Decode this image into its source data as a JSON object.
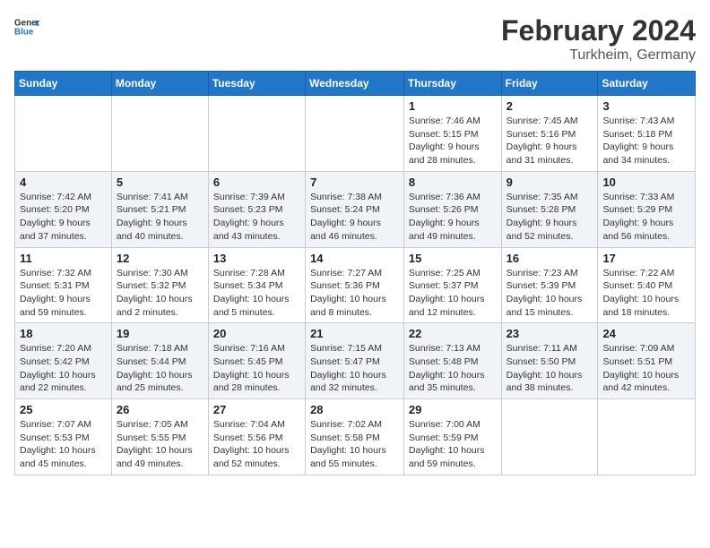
{
  "header": {
    "logo": {
      "line1": "General",
      "line2": "Blue"
    },
    "month": "February 2024",
    "location": "Turkheim, Germany"
  },
  "weekdays": [
    "Sunday",
    "Monday",
    "Tuesday",
    "Wednesday",
    "Thursday",
    "Friday",
    "Saturday"
  ],
  "weeks": [
    [
      null,
      null,
      null,
      null,
      {
        "day": "1",
        "sunrise": "Sunrise: 7:46 AM",
        "sunset": "Sunset: 5:15 PM",
        "daylight": "Daylight: 9 hours and 28 minutes."
      },
      {
        "day": "2",
        "sunrise": "Sunrise: 7:45 AM",
        "sunset": "Sunset: 5:16 PM",
        "daylight": "Daylight: 9 hours and 31 minutes."
      },
      {
        "day": "3",
        "sunrise": "Sunrise: 7:43 AM",
        "sunset": "Sunset: 5:18 PM",
        "daylight": "Daylight: 9 hours and 34 minutes."
      }
    ],
    [
      {
        "day": "4",
        "sunrise": "Sunrise: 7:42 AM",
        "sunset": "Sunset: 5:20 PM",
        "daylight": "Daylight: 9 hours and 37 minutes."
      },
      {
        "day": "5",
        "sunrise": "Sunrise: 7:41 AM",
        "sunset": "Sunset: 5:21 PM",
        "daylight": "Daylight: 9 hours and 40 minutes."
      },
      {
        "day": "6",
        "sunrise": "Sunrise: 7:39 AM",
        "sunset": "Sunset: 5:23 PM",
        "daylight": "Daylight: 9 hours and 43 minutes."
      },
      {
        "day": "7",
        "sunrise": "Sunrise: 7:38 AM",
        "sunset": "Sunset: 5:24 PM",
        "daylight": "Daylight: 9 hours and 46 minutes."
      },
      {
        "day": "8",
        "sunrise": "Sunrise: 7:36 AM",
        "sunset": "Sunset: 5:26 PM",
        "daylight": "Daylight: 9 hours and 49 minutes."
      },
      {
        "day": "9",
        "sunrise": "Sunrise: 7:35 AM",
        "sunset": "Sunset: 5:28 PM",
        "daylight": "Daylight: 9 hours and 52 minutes."
      },
      {
        "day": "10",
        "sunrise": "Sunrise: 7:33 AM",
        "sunset": "Sunset: 5:29 PM",
        "daylight": "Daylight: 9 hours and 56 minutes."
      }
    ],
    [
      {
        "day": "11",
        "sunrise": "Sunrise: 7:32 AM",
        "sunset": "Sunset: 5:31 PM",
        "daylight": "Daylight: 9 hours and 59 minutes."
      },
      {
        "day": "12",
        "sunrise": "Sunrise: 7:30 AM",
        "sunset": "Sunset: 5:32 PM",
        "daylight": "Daylight: 10 hours and 2 minutes."
      },
      {
        "day": "13",
        "sunrise": "Sunrise: 7:28 AM",
        "sunset": "Sunset: 5:34 PM",
        "daylight": "Daylight: 10 hours and 5 minutes."
      },
      {
        "day": "14",
        "sunrise": "Sunrise: 7:27 AM",
        "sunset": "Sunset: 5:36 PM",
        "daylight": "Daylight: 10 hours and 8 minutes."
      },
      {
        "day": "15",
        "sunrise": "Sunrise: 7:25 AM",
        "sunset": "Sunset: 5:37 PM",
        "daylight": "Daylight: 10 hours and 12 minutes."
      },
      {
        "day": "16",
        "sunrise": "Sunrise: 7:23 AM",
        "sunset": "Sunset: 5:39 PM",
        "daylight": "Daylight: 10 hours and 15 minutes."
      },
      {
        "day": "17",
        "sunrise": "Sunrise: 7:22 AM",
        "sunset": "Sunset: 5:40 PM",
        "daylight": "Daylight: 10 hours and 18 minutes."
      }
    ],
    [
      {
        "day": "18",
        "sunrise": "Sunrise: 7:20 AM",
        "sunset": "Sunset: 5:42 PM",
        "daylight": "Daylight: 10 hours and 22 minutes."
      },
      {
        "day": "19",
        "sunrise": "Sunrise: 7:18 AM",
        "sunset": "Sunset: 5:44 PM",
        "daylight": "Daylight: 10 hours and 25 minutes."
      },
      {
        "day": "20",
        "sunrise": "Sunrise: 7:16 AM",
        "sunset": "Sunset: 5:45 PM",
        "daylight": "Daylight: 10 hours and 28 minutes."
      },
      {
        "day": "21",
        "sunrise": "Sunrise: 7:15 AM",
        "sunset": "Sunset: 5:47 PM",
        "daylight": "Daylight: 10 hours and 32 minutes."
      },
      {
        "day": "22",
        "sunrise": "Sunrise: 7:13 AM",
        "sunset": "Sunset: 5:48 PM",
        "daylight": "Daylight: 10 hours and 35 minutes."
      },
      {
        "day": "23",
        "sunrise": "Sunrise: 7:11 AM",
        "sunset": "Sunset: 5:50 PM",
        "daylight": "Daylight: 10 hours and 38 minutes."
      },
      {
        "day": "24",
        "sunrise": "Sunrise: 7:09 AM",
        "sunset": "Sunset: 5:51 PM",
        "daylight": "Daylight: 10 hours and 42 minutes."
      }
    ],
    [
      {
        "day": "25",
        "sunrise": "Sunrise: 7:07 AM",
        "sunset": "Sunset: 5:53 PM",
        "daylight": "Daylight: 10 hours and 45 minutes."
      },
      {
        "day": "26",
        "sunrise": "Sunrise: 7:05 AM",
        "sunset": "Sunset: 5:55 PM",
        "daylight": "Daylight: 10 hours and 49 minutes."
      },
      {
        "day": "27",
        "sunrise": "Sunrise: 7:04 AM",
        "sunset": "Sunset: 5:56 PM",
        "daylight": "Daylight: 10 hours and 52 minutes."
      },
      {
        "day": "28",
        "sunrise": "Sunrise: 7:02 AM",
        "sunset": "Sunset: 5:58 PM",
        "daylight": "Daylight: 10 hours and 55 minutes."
      },
      {
        "day": "29",
        "sunrise": "Sunrise: 7:00 AM",
        "sunset": "Sunset: 5:59 PM",
        "daylight": "Daylight: 10 hours and 59 minutes."
      },
      null,
      null
    ]
  ]
}
